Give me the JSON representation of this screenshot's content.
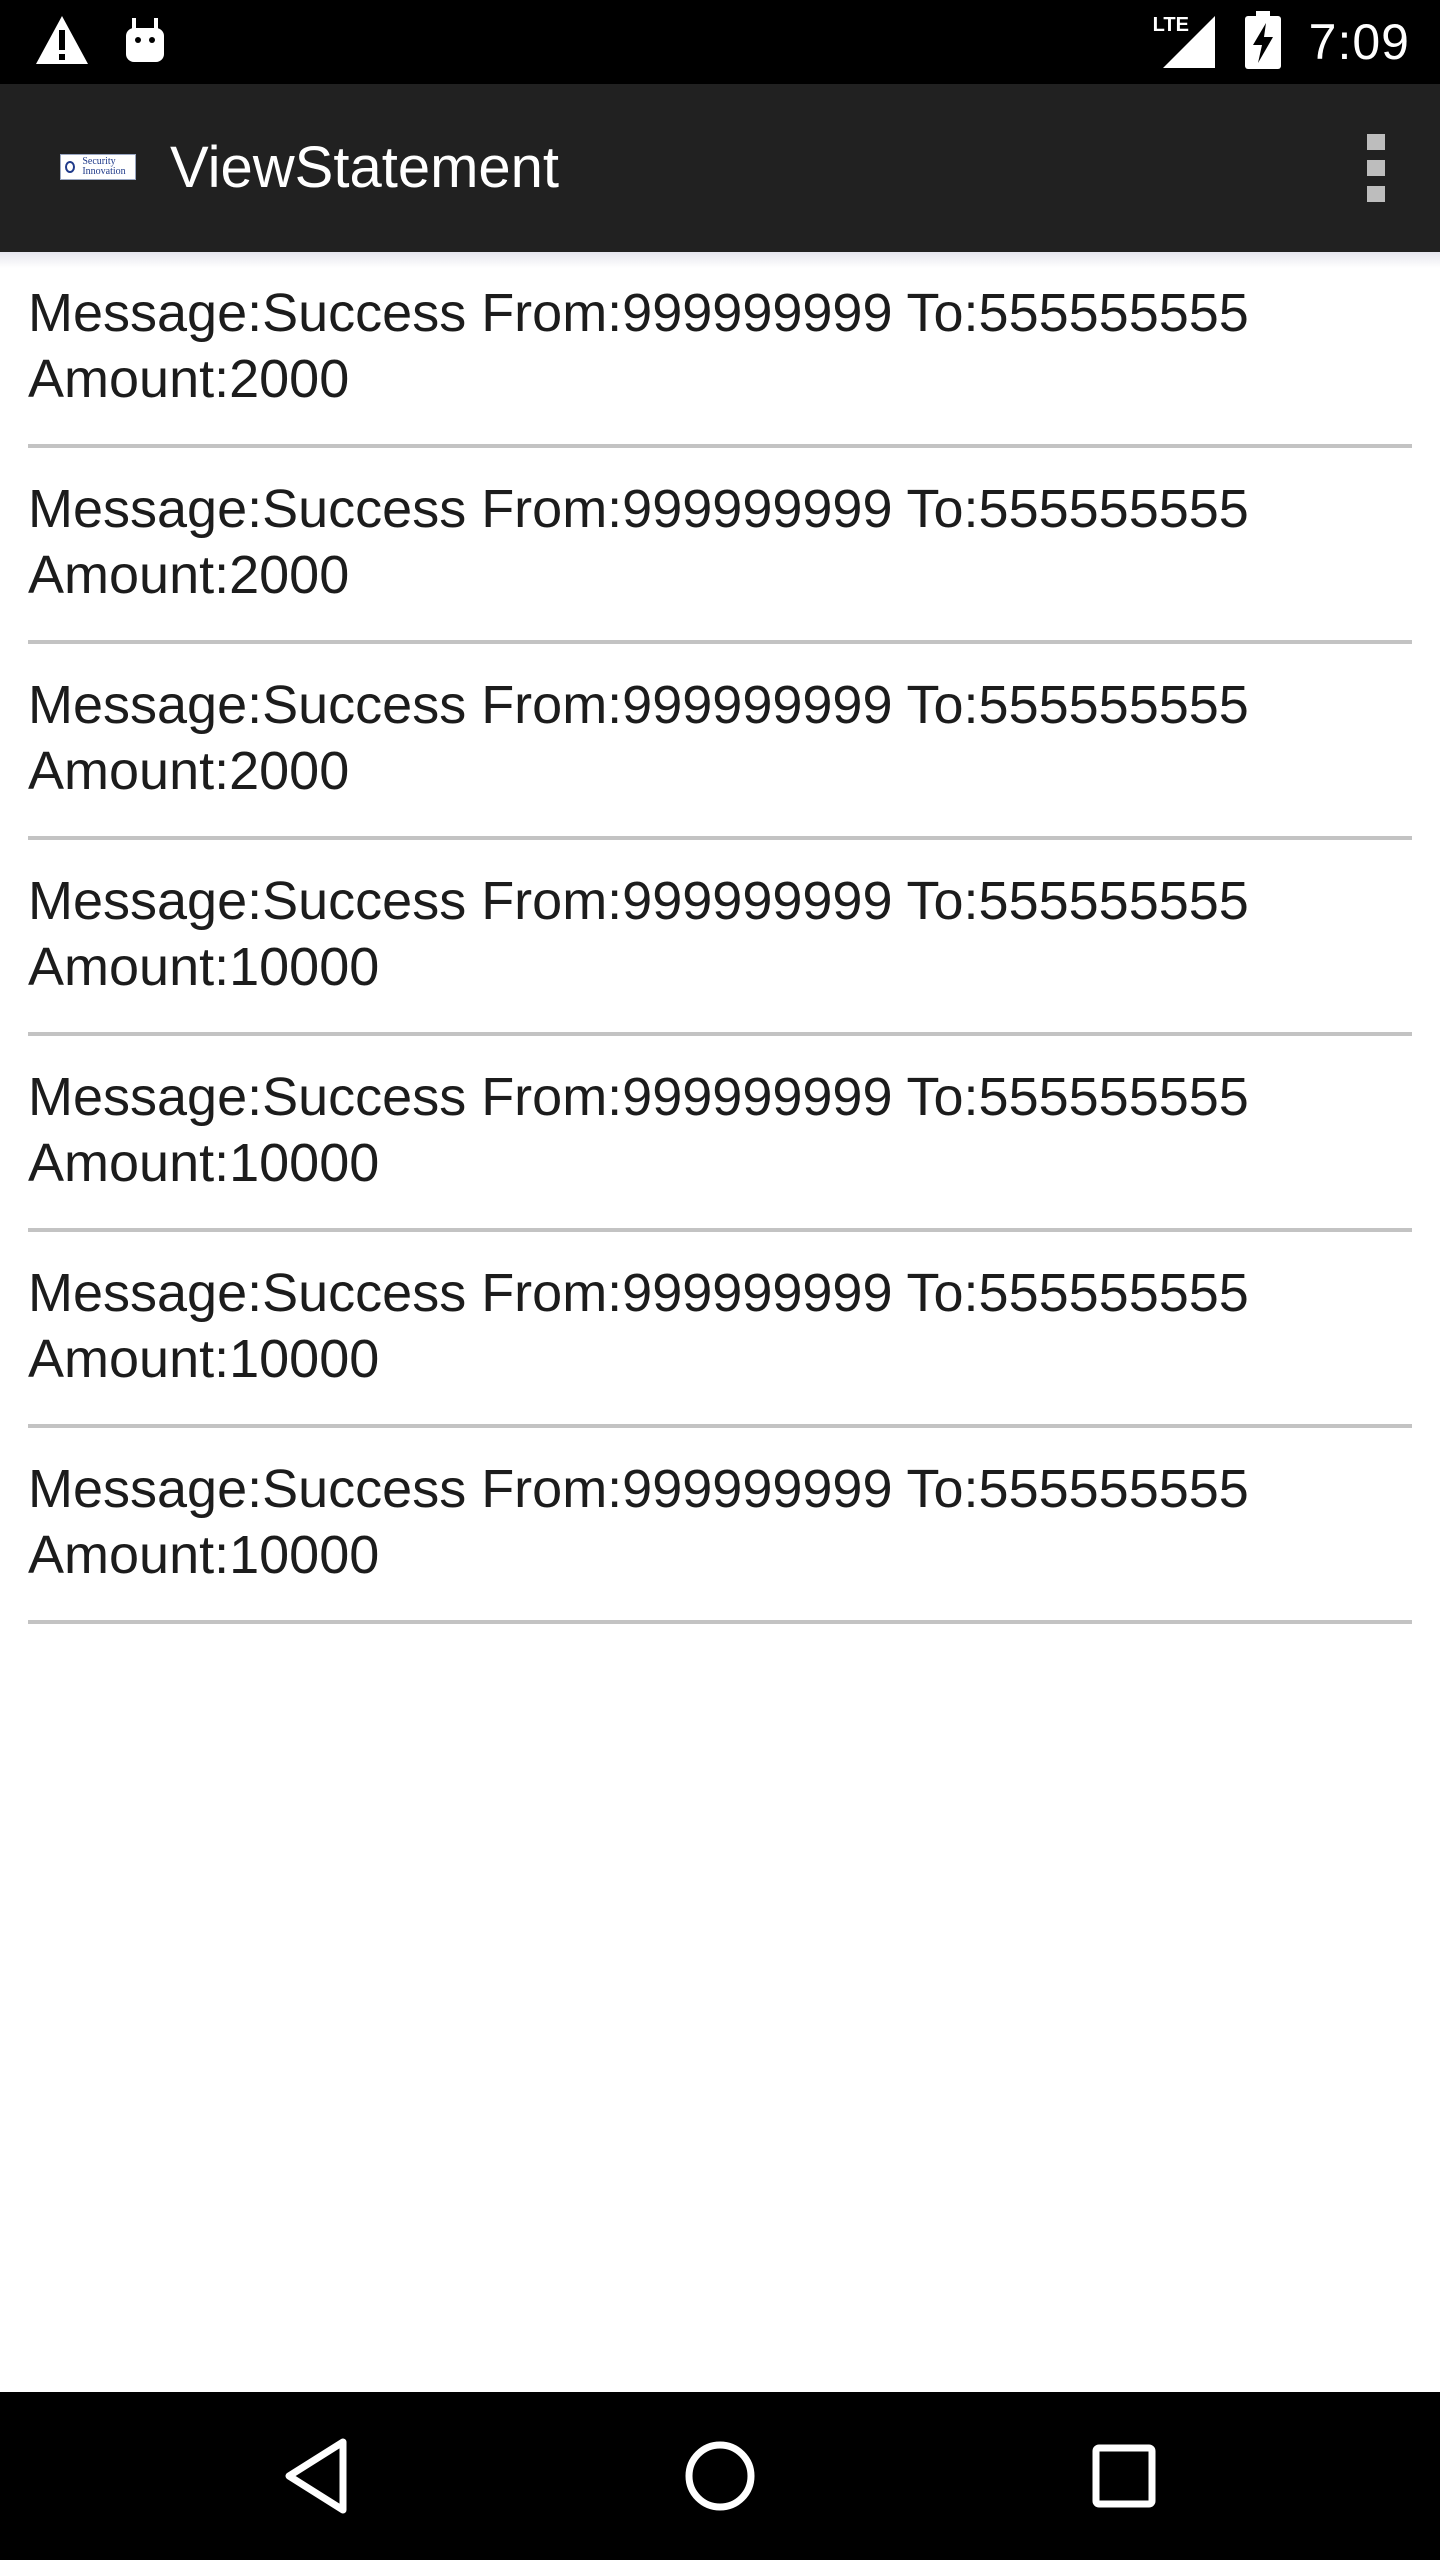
{
  "status_bar": {
    "time": "7:09",
    "network_label": "LTE",
    "icons": [
      "warning-icon",
      "android-debug-icon",
      "lte-signal-icon",
      "battery-charging-icon"
    ]
  },
  "action_bar": {
    "title": "ViewStatement",
    "logo_text_line1": "Security",
    "logo_text_line2": "Innovation",
    "overflow_icon": "more-vert-icon"
  },
  "statements": [
    {
      "line1": "Message:Success From:999999999 To:555555555",
      "line2": "Amount:2000"
    },
    {
      "line1": "Message:Success From:999999999 To:555555555",
      "line2": "Amount:2000"
    },
    {
      "line1": "Message:Success From:999999999 To:555555555",
      "line2": "Amount:2000"
    },
    {
      "line1": "Message:Success From:999999999 To:555555555",
      "line2": "Amount:10000"
    },
    {
      "line1": "Message:Success From:999999999 To:555555555",
      "line2": "Amount:10000"
    },
    {
      "line1": "Message:Success From:999999999 To:555555555",
      "line2": "Amount:10000"
    },
    {
      "line1": "Message:Success From:999999999 To:555555555",
      "line2": "Amount:10000"
    }
  ],
  "nav_bar": {
    "icons": [
      "back-icon",
      "home-icon",
      "recents-icon"
    ]
  },
  "colors": {
    "status_bar": "#000000",
    "action_bar": "#212121",
    "background": "#ffffff",
    "divider": "#c3c3c3"
  }
}
